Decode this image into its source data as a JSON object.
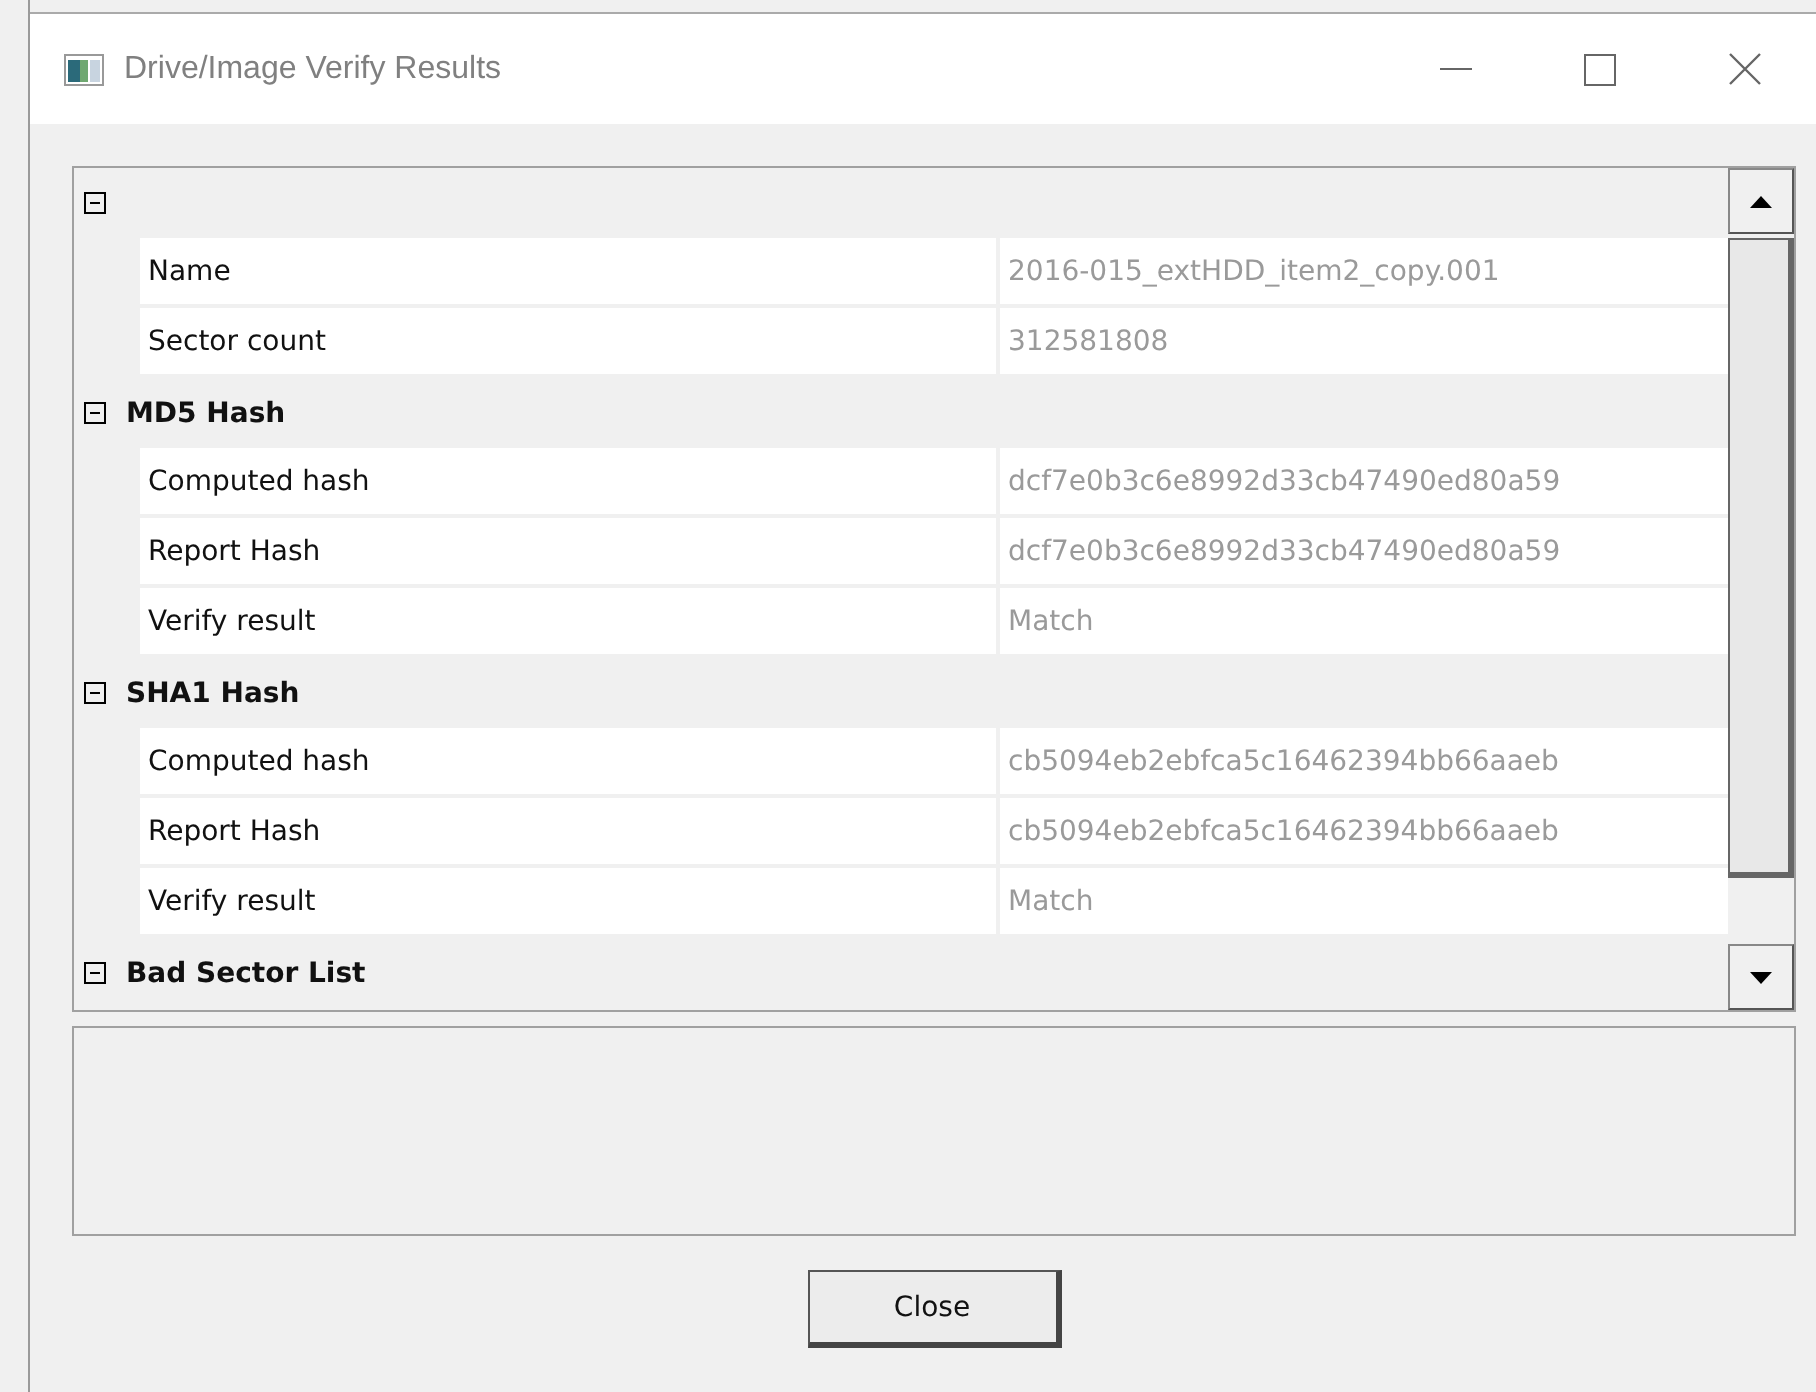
{
  "window": {
    "title": "Drive/Image Verify Results"
  },
  "groups": [
    {
      "expanded": true,
      "items": [
        {
          "label": "Name",
          "value": "2016-015_extHDD_item2_copy.001"
        },
        {
          "label": "Sector count",
          "value": "312581808"
        }
      ]
    },
    {
      "title": "MD5 Hash",
      "expanded": true,
      "items": [
        {
          "label": "Computed hash",
          "value": "dcf7e0b3c6e8992d33cb47490ed80a59"
        },
        {
          "label": "Report Hash",
          "value": "dcf7e0b3c6e8992d33cb47490ed80a59"
        },
        {
          "label": "Verify result",
          "value": "Match"
        }
      ]
    },
    {
      "title": "SHA1 Hash",
      "expanded": true,
      "items": [
        {
          "label": "Computed hash",
          "value": "cb5094eb2ebfca5c16462394bb66aaeb"
        },
        {
          "label": "Report Hash",
          "value": "cb5094eb2ebfca5c16462394bb66aaeb"
        },
        {
          "label": "Verify result",
          "value": "Match"
        }
      ]
    },
    {
      "title": "Bad Sector List",
      "expanded": true
    }
  ],
  "buttons": [
    {
      "label": "Close"
    }
  ]
}
